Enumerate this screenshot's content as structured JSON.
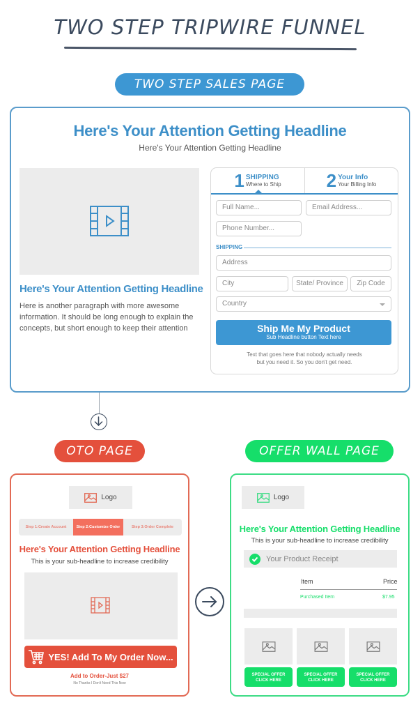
{
  "title": "TWO STEP TRIPWIRE FUNNEL",
  "colors": {
    "sales_blue": "#3d97d3",
    "oto_red": "#e4503c",
    "wall_green": "#16de6a",
    "title_dark": "#3b4a5e"
  },
  "sales_page": {
    "pill_label": "TWO STEP SALES PAGE",
    "headline": "Here's Your Attention Getting Headline",
    "subheadline": "Here's Your Attention Getting Headline",
    "video_icon": "video-film-icon",
    "left_headline": "Here's Your Attention Getting Headline",
    "left_paragraph": "Here is another paragraph with more awesome information. It should be long enough to explain the concepts, but short enough to keep their attention",
    "form": {
      "tabs": [
        {
          "number": "1",
          "title": "SHIPPING",
          "subtitle": "Where to Ship",
          "active": true
        },
        {
          "number": "2",
          "title": "Your Info",
          "subtitle": "Your Billing Info",
          "active": false
        }
      ],
      "fields": {
        "full_name": "Full Name...",
        "email": "Email Address...",
        "phone": "Phone Number...",
        "address": "Address",
        "city": "City",
        "state": "State/ Province",
        "zip": "Zip Code",
        "country": "Country"
      },
      "section_label": "SHIPPING",
      "button_title": "Ship Me My Product",
      "button_sub": "Sub Headline button Text here",
      "note_line1": "Text that goes here that nobody actually needs",
      "note_line2": "but you need it. So you don't get need."
    }
  },
  "oto_page": {
    "pill_label": "OTO PAGE",
    "logo_label": "Logo",
    "steps": [
      {
        "label": "Step 1:Create Account",
        "active": false
      },
      {
        "label": "Step 2:Customize Order",
        "active": true
      },
      {
        "label": "Step 3:Order Complete",
        "active": false
      }
    ],
    "headline": "Here's Your Attention Getting Headline",
    "subheadline": "This is your sub-headline to increase credibility",
    "button_label": "YES! Add To My Order Now...",
    "price_text": "Add to Order-Just $27",
    "no_thanks": "No Thanks I Don't Need This Now"
  },
  "offer_wall_page": {
    "pill_label": "OFFER WALL PAGE",
    "logo_label": "Logo",
    "headline": "Here's Your Attention Getting Headline",
    "subheadline": "This is your sub-headline to increase credibility",
    "receipt_label": "Your Product Receipt",
    "table": {
      "columns": [
        "Item",
        "Price"
      ],
      "rows": [
        {
          "item": "Purchased Item",
          "price": "$7.95"
        }
      ]
    },
    "offers": [
      {
        "line1": "SPECIAL OFFER",
        "line2": "CLICK HERE"
      },
      {
        "line1": "SPECIAL OFFER",
        "line2": "CLICK HERE"
      },
      {
        "line1": "SPECIAL OFFER",
        "line2": "CLICK HERE"
      }
    ]
  }
}
